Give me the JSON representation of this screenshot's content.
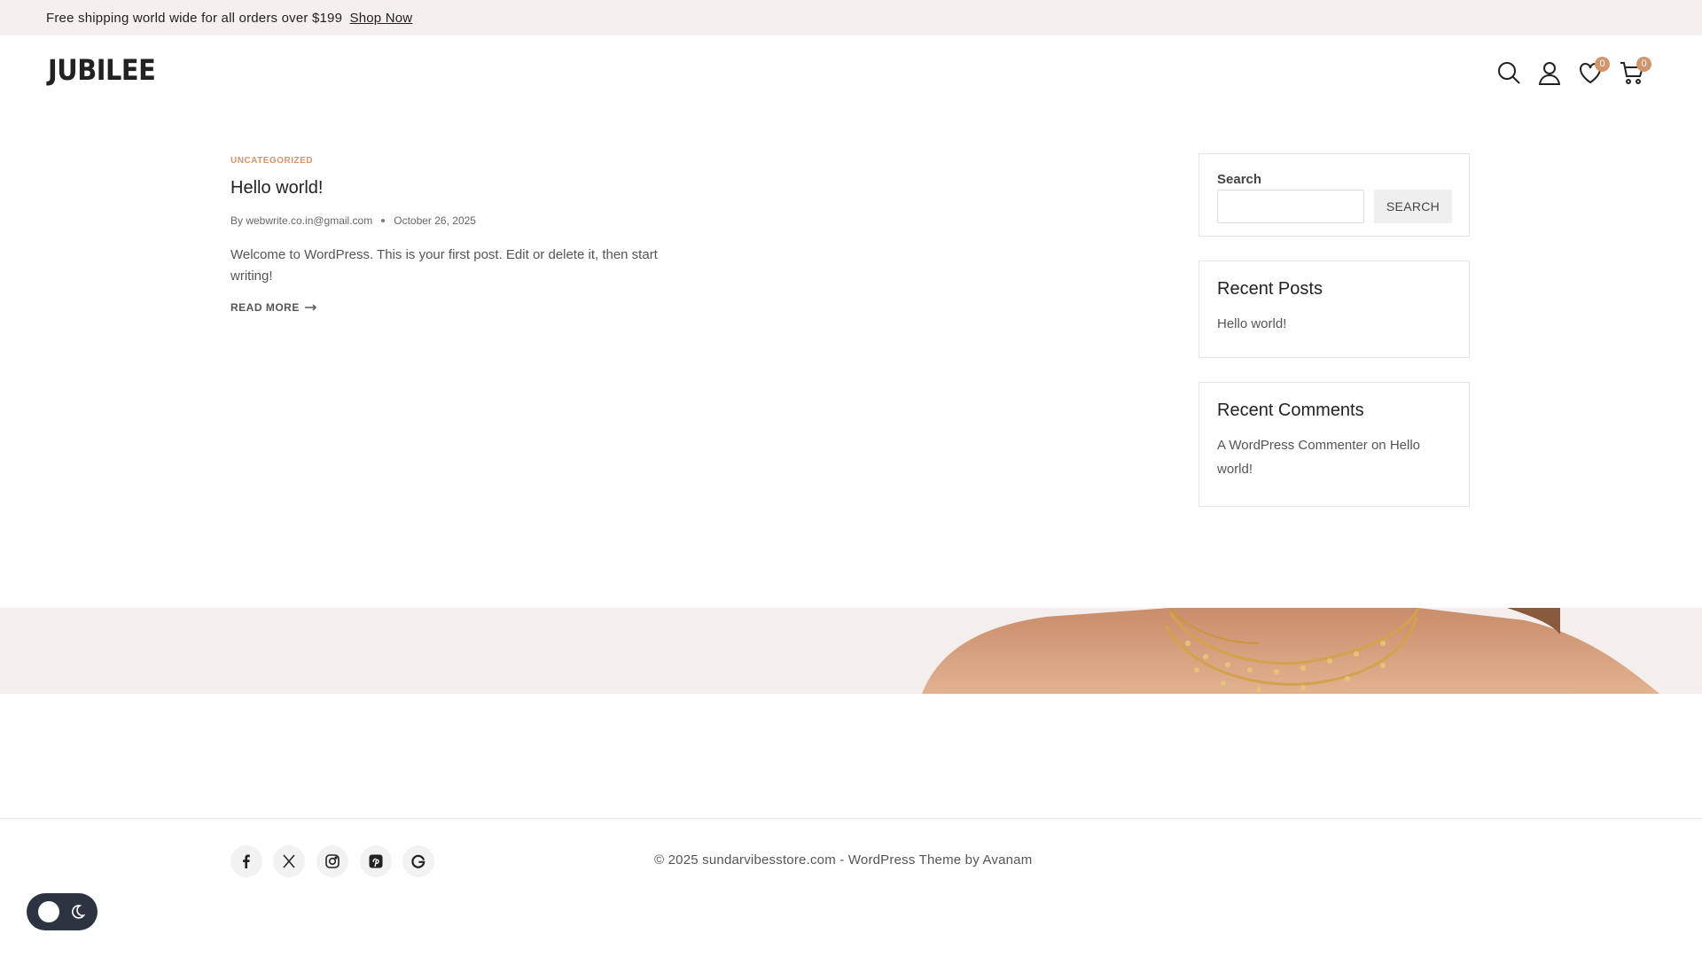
{
  "topbar": {
    "message": "Free shipping world wide for all orders over $199",
    "link": "Shop Now"
  },
  "header": {
    "logo": "JUBILEE",
    "icons": [
      "search-icon",
      "user-icon",
      "heart-icon",
      "cart-icon"
    ],
    "wishlist_count": "0",
    "cart_count": "0"
  },
  "post": {
    "category": "UNCATEGORIZED",
    "title": "Hello world!",
    "author": "By webwrite.co.in@gmail.com",
    "date": "October 26, 2025",
    "excerpt": "Welcome to WordPress. This is your first post. Edit or delete it, then start writing!",
    "read_more": "READ MORE"
  },
  "sidebar": {
    "search": {
      "label": "Search",
      "placeholder": "",
      "button": "SEARCH"
    },
    "recent_posts": {
      "title": "Recent Posts",
      "items": [
        "Hello world!"
      ]
    },
    "recent_comments": {
      "title": "Recent Comments",
      "author": "A WordPress Commenter",
      "on": "on",
      "post": "Hello world!"
    }
  },
  "footer": {
    "social": [
      "facebook-icon",
      "x-icon",
      "instagram-icon",
      "pinterest-icon",
      "google-icon"
    ],
    "copyright": "© 2025 sundarvibesstore.com - WordPress Theme by Avanam"
  },
  "colors": {
    "accent": "#d3956d",
    "topbar_bg": "#f4f0ec",
    "toggle_bg": "#2c3442"
  }
}
